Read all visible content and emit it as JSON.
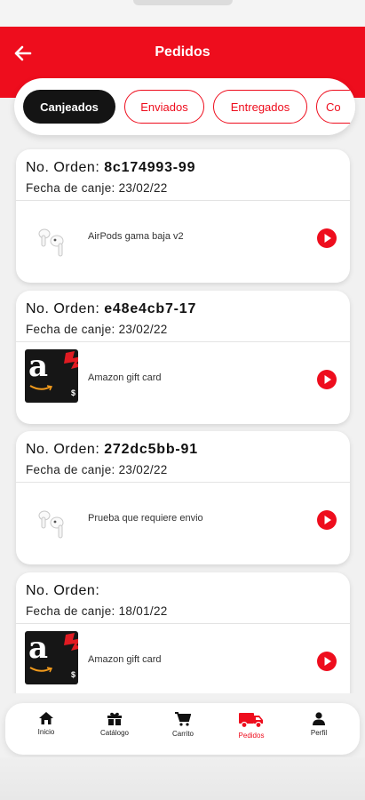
{
  "header": {
    "title": "Pedidos",
    "back_icon": "arrow-left-icon",
    "background": "#ee0d1d"
  },
  "tabs": [
    {
      "label": "Canjeados",
      "active": true
    },
    {
      "label": "Enviados",
      "active": false
    },
    {
      "label": "Entregados",
      "active": false
    },
    {
      "label": "Co",
      "active": false
    }
  ],
  "orders": [
    {
      "order_label": "No. Orden:",
      "order_id": "8c174993-99",
      "date_label": "Fecha de canje: 23/02/22",
      "product": "AirPods gama baja v2",
      "image": "airpods"
    },
    {
      "order_label": "No. Orden:",
      "order_id": "e48e4cb7-17",
      "date_label": "Fecha de canje: 23/02/22",
      "product": "Amazon gift card",
      "image": "amazon"
    },
    {
      "order_label": "No. Orden:",
      "order_id": "272dc5bb-91",
      "date_label": "Fecha de canje: 23/02/22",
      "product": "Prueba que requiere envio",
      "image": "airpods"
    },
    {
      "order_label": "No. Orden:",
      "order_id": "",
      "date_label": "Fecha de canje: 18/01/22",
      "product": "Amazon gift card",
      "image": "amazon"
    }
  ],
  "bottom_nav": [
    {
      "label": "Inicio",
      "icon": "home-icon",
      "active": false
    },
    {
      "label": "Catálogo",
      "icon": "gift-icon",
      "active": false
    },
    {
      "label": "Carrito",
      "icon": "cart-icon",
      "active": false
    },
    {
      "label": "Pedidos",
      "icon": "truck-icon",
      "active": true
    },
    {
      "label": "Perfil",
      "icon": "person-icon",
      "active": false
    }
  ],
  "colors": {
    "accent": "#ee0d1d",
    "active_tab": "#141414"
  }
}
